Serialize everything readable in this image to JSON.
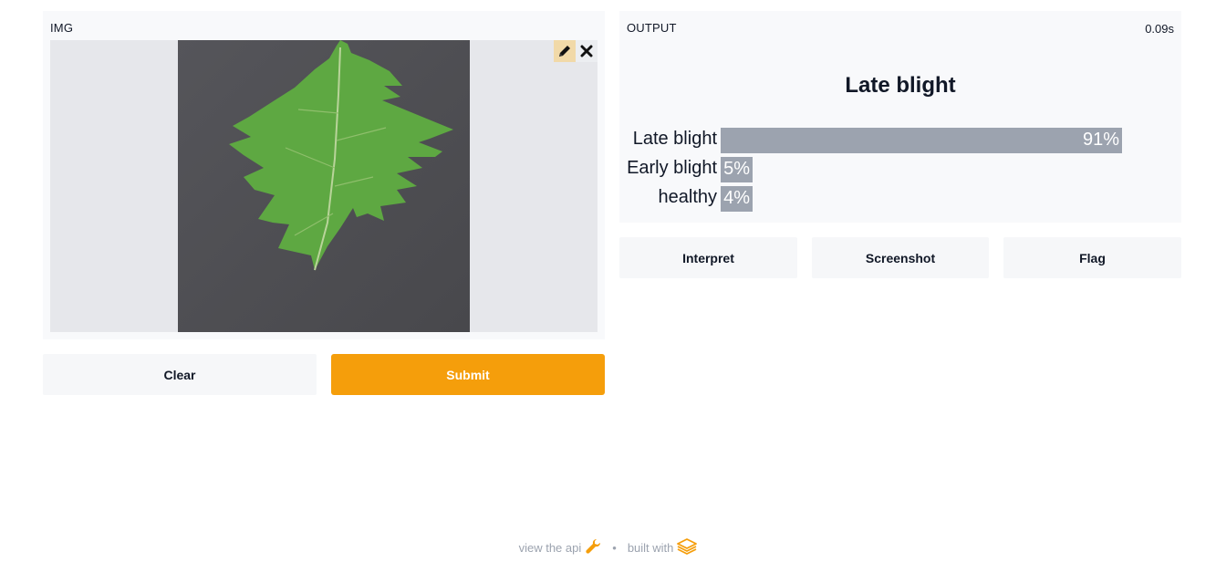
{
  "input": {
    "label": "IMG",
    "tools": {
      "edit_icon": "pencil-icon",
      "close_icon": "close-icon"
    }
  },
  "buttons": {
    "clear": "Clear",
    "submit": "Submit"
  },
  "output": {
    "label": "OUTPUT",
    "timing": "0.09s",
    "top_label": "Late blight",
    "confidences": [
      {
        "label": "Late blight",
        "pct": "91%",
        "value": 0.91
      },
      {
        "label": "Early blight",
        "pct": "5%",
        "value": 0.05
      },
      {
        "label": "healthy",
        "pct": "4%",
        "value": 0.04
      }
    ]
  },
  "actions": {
    "interpret": "Interpret",
    "screenshot": "Screenshot",
    "flag": "Flag"
  },
  "footer": {
    "api_text": "view the api",
    "dot": "•",
    "built_text": "built with"
  },
  "colors": {
    "accent": "#f59e0b",
    "bar": "#9ca3af",
    "panel": "#f8f9fb"
  }
}
